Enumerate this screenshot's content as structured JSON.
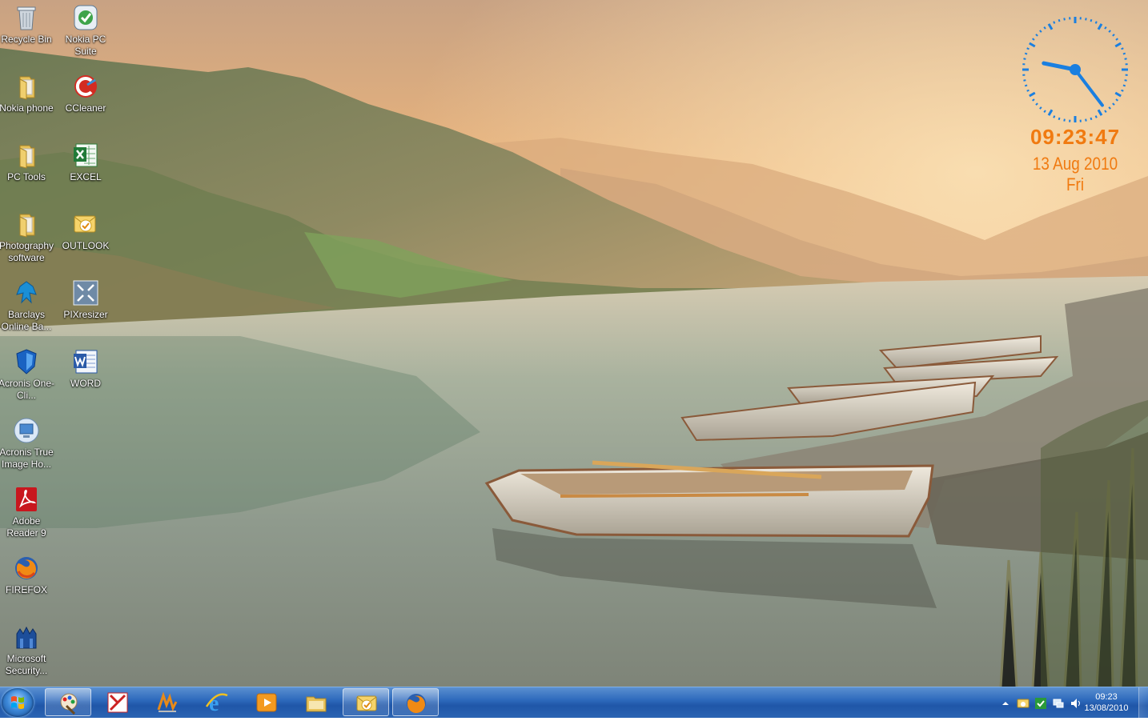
{
  "desktop": {
    "icons": [
      {
        "label": "Recycle Bin",
        "icon": "recycle-bin-icon"
      },
      {
        "label": "Nokia PC Suite",
        "icon": "nokia-pc-suite-icon"
      },
      {
        "label": "Nokia phone",
        "icon": "folder-icon"
      },
      {
        "label": "CCleaner",
        "icon": "ccleaner-icon"
      },
      {
        "label": "PC Tools",
        "icon": "folder-icon"
      },
      {
        "label": "EXCEL",
        "icon": "excel-icon"
      },
      {
        "label": "Photography software",
        "icon": "folder-icon"
      },
      {
        "label": "OUTLOOK",
        "icon": "outlook-icon"
      },
      {
        "label": "Barclays Online Ba...",
        "icon": "barclays-icon"
      },
      {
        "label": "PIXresizer",
        "icon": "pixresizer-icon"
      },
      {
        "label": "Acronis One-Cli...",
        "icon": "acronis-shield-icon"
      },
      {
        "label": "WORD",
        "icon": "word-icon"
      },
      {
        "label": "Acronis True Image Ho...",
        "icon": "acronis-true-image-icon"
      },
      {
        "label": "Adobe Reader 9",
        "icon": "adobe-reader-icon"
      },
      {
        "label": "FIREFOX",
        "icon": "firefox-icon"
      },
      {
        "label": "Microsoft Security...",
        "icon": "microsoft-security-icon"
      }
    ]
  },
  "clock_gadget": {
    "time": "09:23:47",
    "date": "13 Aug 2010 Fri",
    "hour": 9,
    "minute": 23,
    "second": 47,
    "color": "#f07a10",
    "face_color": "#1a7fe0"
  },
  "taskbar": {
    "start_label": "Start",
    "buttons": [
      {
        "icon": "paint-icon",
        "open": true
      },
      {
        "icon": "kaspersky-icon",
        "open": false
      },
      {
        "icon": "winamp-icon",
        "open": false
      },
      {
        "icon": "internet-explorer-icon",
        "open": false
      },
      {
        "icon": "media-player-icon",
        "open": false
      },
      {
        "icon": "windows-explorer-icon",
        "open": false
      },
      {
        "icon": "outlook-icon",
        "open": true
      },
      {
        "icon": "firefox-icon",
        "open": true
      }
    ],
    "tray": {
      "time": "09:23",
      "date": "13/08/2010",
      "icons": [
        "show-hidden-icons-arrow-icon",
        "outlook-tray-icon",
        "security-check-icon",
        "network-icon",
        "volume-icon"
      ]
    }
  }
}
